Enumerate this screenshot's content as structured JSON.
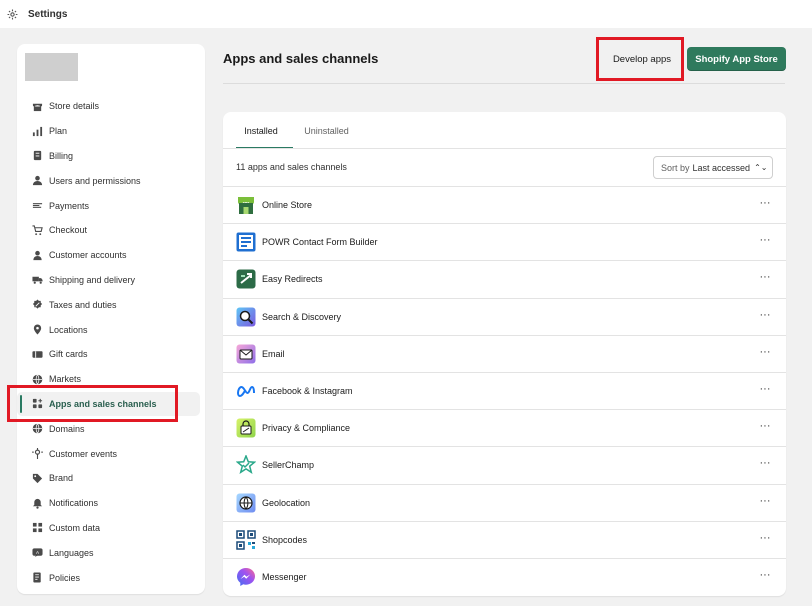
{
  "topbar": {
    "title": "Settings"
  },
  "sidebar": {
    "items": [
      {
        "label": "Store details",
        "icon": "store-icon"
      },
      {
        "label": "Plan",
        "icon": "plan-icon"
      },
      {
        "label": "Billing",
        "icon": "billing-icon"
      },
      {
        "label": "Users and permissions",
        "icon": "users-icon"
      },
      {
        "label": "Payments",
        "icon": "payments-icon"
      },
      {
        "label": "Checkout",
        "icon": "cart-icon"
      },
      {
        "label": "Customer accounts",
        "icon": "person-icon"
      },
      {
        "label": "Shipping and delivery",
        "icon": "truck-icon"
      },
      {
        "label": "Taxes and duties",
        "icon": "tax-icon"
      },
      {
        "label": "Locations",
        "icon": "location-pin-icon"
      },
      {
        "label": "Gift cards",
        "icon": "gift-card-icon"
      },
      {
        "label": "Markets",
        "icon": "globe-icon"
      },
      {
        "label": "Apps and sales channels",
        "icon": "apps-icon",
        "active": true
      },
      {
        "label": "Domains",
        "icon": "domains-globe-icon"
      },
      {
        "label": "Customer events",
        "icon": "customer-events-icon"
      },
      {
        "label": "Brand",
        "icon": "brand-icon"
      },
      {
        "label": "Notifications",
        "icon": "bell-icon"
      },
      {
        "label": "Custom data",
        "icon": "database-icon"
      },
      {
        "label": "Languages",
        "icon": "languages-icon"
      },
      {
        "label": "Policies",
        "icon": "policies-icon"
      }
    ]
  },
  "header": {
    "title": "Apps and sales channels",
    "develop_apps": "Develop apps",
    "app_store": "Shopify App Store"
  },
  "tabs": {
    "installed": "Installed",
    "uninstalled": "Uninstalled"
  },
  "list": {
    "count": "11 apps and sales channels",
    "sort_prefix": "Sort by",
    "sort_value": "Last accessed",
    "more": "···",
    "apps": [
      {
        "name": "Online Store",
        "icon": "online-store-icon"
      },
      {
        "name": "POWR Contact Form Builder",
        "icon": "powr-form-icon"
      },
      {
        "name": "Easy Redirects",
        "icon": "easy-redirects-icon"
      },
      {
        "name": "Search & Discovery",
        "icon": "search-discovery-icon"
      },
      {
        "name": "Email",
        "icon": "email-icon"
      },
      {
        "name": "Facebook & Instagram",
        "icon": "meta-icon"
      },
      {
        "name": "Privacy & Compliance",
        "icon": "privacy-icon"
      },
      {
        "name": "SellerChamp",
        "icon": "sellerchamp-icon"
      },
      {
        "name": "Geolocation",
        "icon": "geolocation-icon"
      },
      {
        "name": "Shopcodes",
        "icon": "qr-code-icon"
      },
      {
        "name": "Messenger",
        "icon": "messenger-icon"
      }
    ]
  },
  "colors": {
    "primary": "#2f7a5d",
    "highlight": "#e11924",
    "active_bar": "#2a7a62"
  }
}
